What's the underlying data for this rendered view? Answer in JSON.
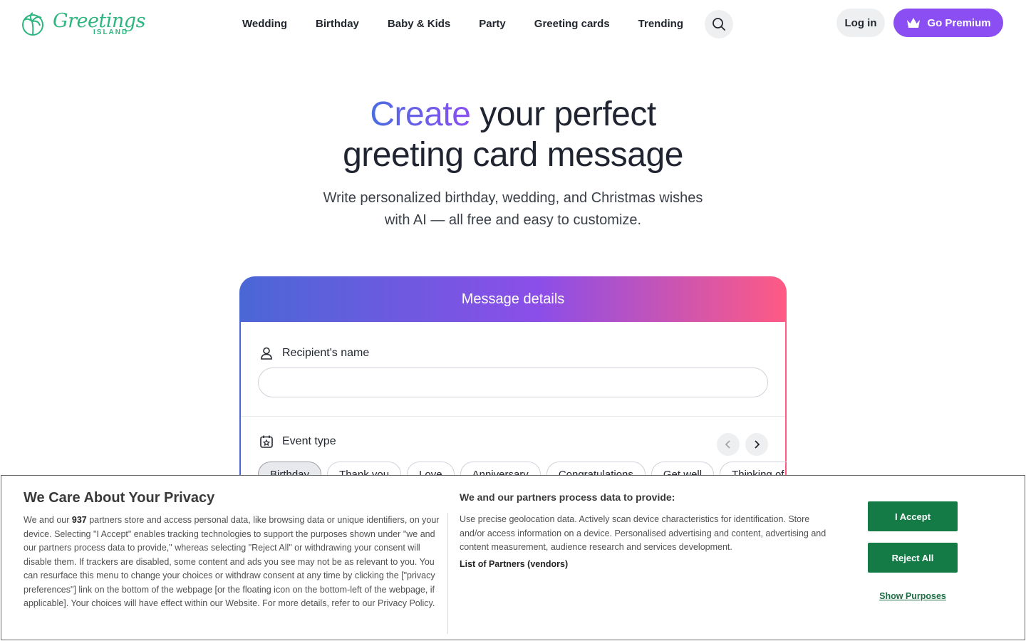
{
  "header": {
    "logo_word": "Greetings",
    "logo_sub": "ISLAND",
    "nav": [
      "Wedding",
      "Birthday",
      "Baby & Kids",
      "Party",
      "Greeting cards",
      "Trending"
    ],
    "search_icon": "search-icon",
    "login_label": "Log in",
    "premium_label": "Go Premium",
    "premium_icon": "crown-icon",
    "colors": {
      "brand_green": "#2db67f",
      "premium_purple": "#8a4ef2"
    }
  },
  "hero": {
    "title_highlight": "Create",
    "title_rest_line1": " your perfect",
    "title_line2": "greeting card message",
    "subtitle_line1": "Write personalized birthday, wedding, and Christmas wishes",
    "subtitle_line2": "with AI — all free and easy to customize."
  },
  "card": {
    "header": "Message details",
    "recipient_label": "Recipient's name",
    "recipient_value": "",
    "event_label": "Event type",
    "event_chips": [
      "Birthday",
      "Thank you",
      "Love",
      "Anniversary",
      "Congratulations",
      "Get well",
      "Thinking of you"
    ],
    "selected_chip": "Birthday",
    "gradient": [
      "#4a67d6",
      "#8c4ee8",
      "#ff5a84"
    ]
  },
  "consent": {
    "title": "We Care About Your Privacy",
    "text_before_count": "We and our ",
    "partner_count": "937",
    "text_after_count": " partners store and access personal data, like browsing data or unique identifiers, on your device. Selecting \"I Accept\" enables tracking technologies to support the purposes shown under \"we and our partners process data to provide,\" whereas selecting \"Reject All\" or withdrawing your consent will disable them. If trackers are disabled, some content and ads you see may not be as relevant to you. You can resurface this menu to change your choices or withdraw consent at any time by clicking the [\"privacy preferences\"] link on the bottom of the webpage [or the floating icon on the bottom-left of the webpage, if applicable]. Your choices will have effect within our Website. For more details, refer to our Privacy Policy.",
    "purposes_title": "We and our partners process data to provide:",
    "purposes_text": "Use precise geolocation data. Actively scan device characteristics for identification. Store and/or access information on a device. Personalised advertising and content, advertising and content measurement, audience research and services development.",
    "vendors_link": "List of Partners (vendors)",
    "accept_label": "I Accept",
    "reject_label": "Reject All",
    "show_purposes_label": "Show Purposes",
    "button_color": "#147a46"
  }
}
